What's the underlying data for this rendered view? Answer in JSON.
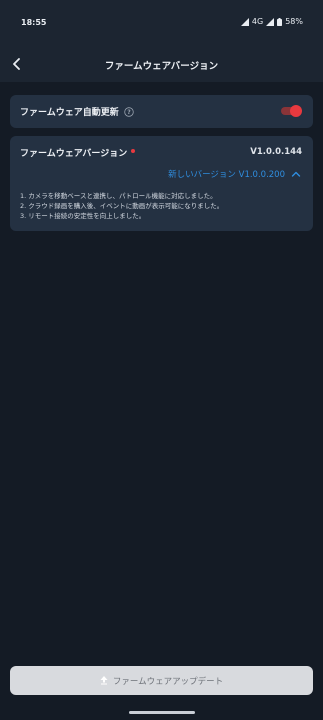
{
  "status_bar": {
    "time": "18:55",
    "network": "4G",
    "battery": "58%"
  },
  "header": {
    "title": "ファームウェアバージョン"
  },
  "auto_update": {
    "label": "ファームウェア自動更新",
    "enabled": true
  },
  "firmware": {
    "title": "ファームウェアバージョン",
    "current_version": "V1.0.0.144",
    "new_version_label": "新しいバージョン V1.0.0.200",
    "release_notes": [
      "1. カメラを移動ベースと連携し、パトロール機能に対応しました。",
      "2. クラウド録画を購入後、イベントに動画が表示可能になりました。",
      "3. リモート接続の安定性を向上しました。"
    ]
  },
  "update_button": {
    "label": "ファームウェアアップデート"
  },
  "colors": {
    "accent_red": "#e8393f",
    "link_blue": "#2f8ee0",
    "card_bg": "#243142",
    "page_bg": "#141b25"
  }
}
